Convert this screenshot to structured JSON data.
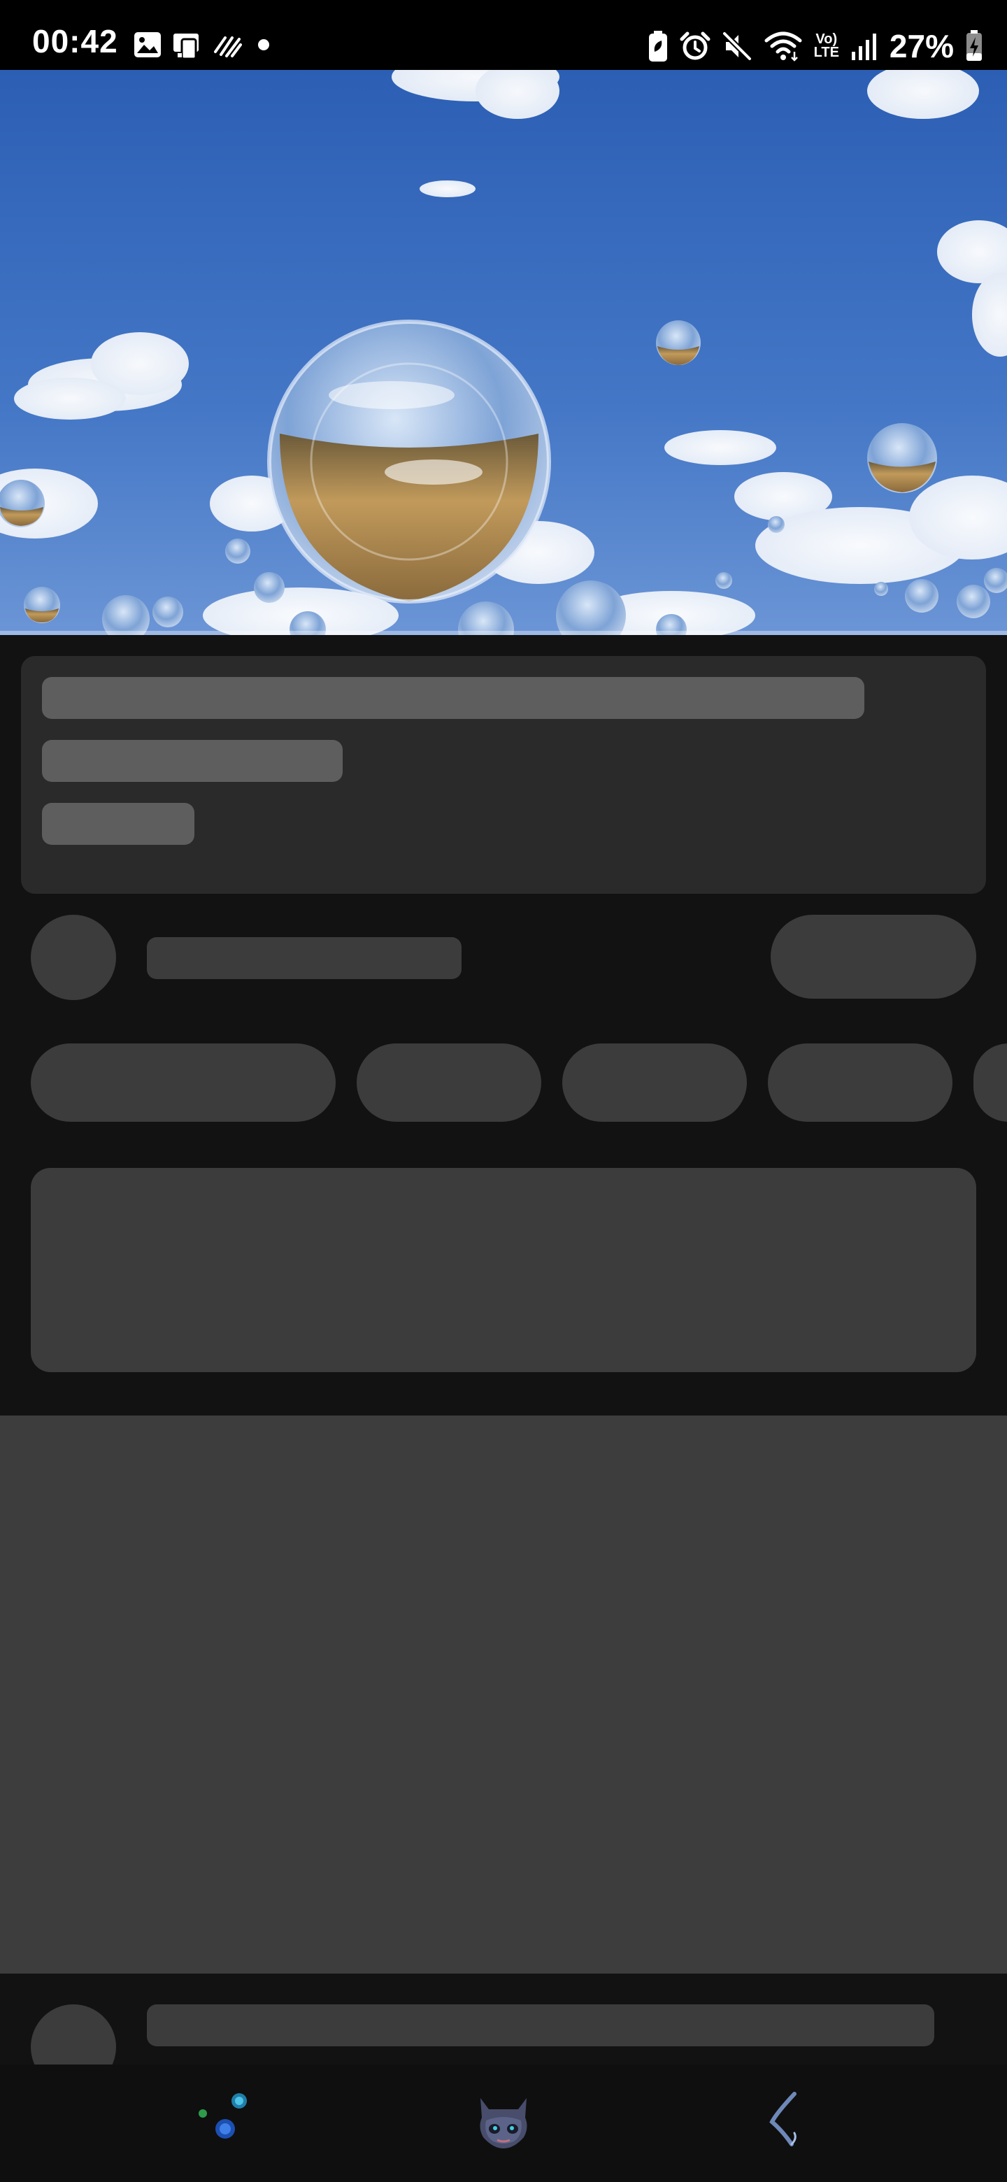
{
  "status_bar": {
    "time": "00:42",
    "battery_percent": "27%",
    "left_icons": [
      "gallery-icon",
      "device-icon",
      "tasks-icon",
      "dot-icon"
    ],
    "right_icons": [
      "battery-saver-icon",
      "alarm-icon",
      "mute-icon",
      "wifi-icon",
      "volte-icon",
      "signal-icon",
      "battery-charging-icon"
    ],
    "volte_label_top": "Vo)",
    "volte_label_bottom": "LTE"
  },
  "video": {
    "description_icon": "video-player",
    "progress": 0.0
  },
  "skeleton": {
    "state": "loading"
  },
  "navbar": {
    "icons": [
      "recent-apps-icon",
      "home-mascot-icon",
      "back-icon"
    ]
  },
  "colors": {
    "background": "#0f0f0f",
    "skeleton_block": "#3c3c3c",
    "skeleton_highlight": "#5e5e5e",
    "card": "#2a2a2a",
    "sky": "#3b6bbf"
  }
}
